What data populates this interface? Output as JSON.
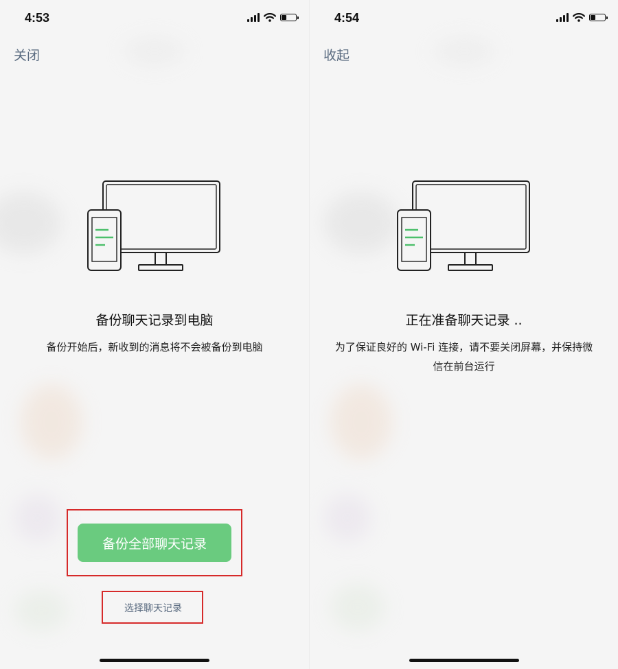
{
  "screens": [
    {
      "status_time": "4:53",
      "nav_action": "关闭",
      "title": "备份聊天记录到电脑",
      "description": "备份开始后，新收到的消息将不会被备份到电脑",
      "primary_button": "备份全部聊天记录",
      "secondary_link": "选择聊天记录"
    },
    {
      "status_time": "4:54",
      "nav_action": "收起",
      "title": "正在准备聊天记录 ..",
      "description": "为了保证良好的 Wi-Fi 连接，请不要关闭屏幕，并保持微信在前台运行"
    }
  ],
  "colors": {
    "accent_green": "#6acb7f",
    "link_color": "#5a6b80",
    "highlight_red": "#d62a2a"
  },
  "icons": [
    "signal-icon",
    "wifi-icon",
    "battery-icon",
    "phone-to-computer-illustration"
  ]
}
